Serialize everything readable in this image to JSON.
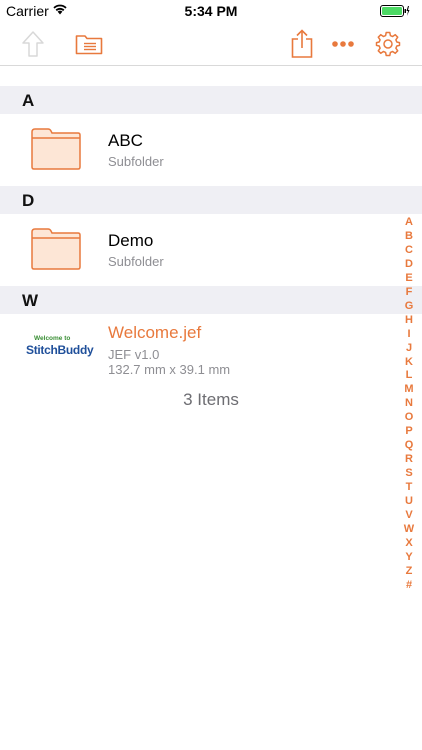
{
  "status": {
    "carrier": "Carrier",
    "time": "5:34 PM"
  },
  "toolbar": {
    "up_icon": "up-arrow-icon",
    "folder_list_icon": "folder-list-icon",
    "share_icon": "share-icon",
    "more_icon": "more-icon",
    "settings_icon": "gear-icon"
  },
  "colors": {
    "accent": "#e8793d",
    "header_bg": "#efeff4",
    "subtext": "#8e8e93"
  },
  "sections": [
    {
      "letter": "A",
      "items": [
        {
          "title": "ABC",
          "subtitle": "Subfolder",
          "type": "folder"
        }
      ]
    },
    {
      "letter": "D",
      "items": [
        {
          "title": "Demo",
          "subtitle": "Subfolder",
          "type": "folder"
        }
      ]
    },
    {
      "letter": "W",
      "items": [
        {
          "title": "Welcome.jef",
          "line1": "JEF v1.0",
          "line2": "132.7 mm x 39.1 mm",
          "type": "file",
          "logo_line1": "Welcome to",
          "logo_line2": "StitchBuddy"
        }
      ]
    }
  ],
  "footer": {
    "count": "3 Items"
  },
  "index": [
    "A",
    "B",
    "C",
    "D",
    "E",
    "F",
    "G",
    "H",
    "I",
    "J",
    "K",
    "L",
    "M",
    "N",
    "O",
    "P",
    "Q",
    "R",
    "S",
    "T",
    "U",
    "V",
    "W",
    "X",
    "Y",
    "Z",
    "#"
  ]
}
